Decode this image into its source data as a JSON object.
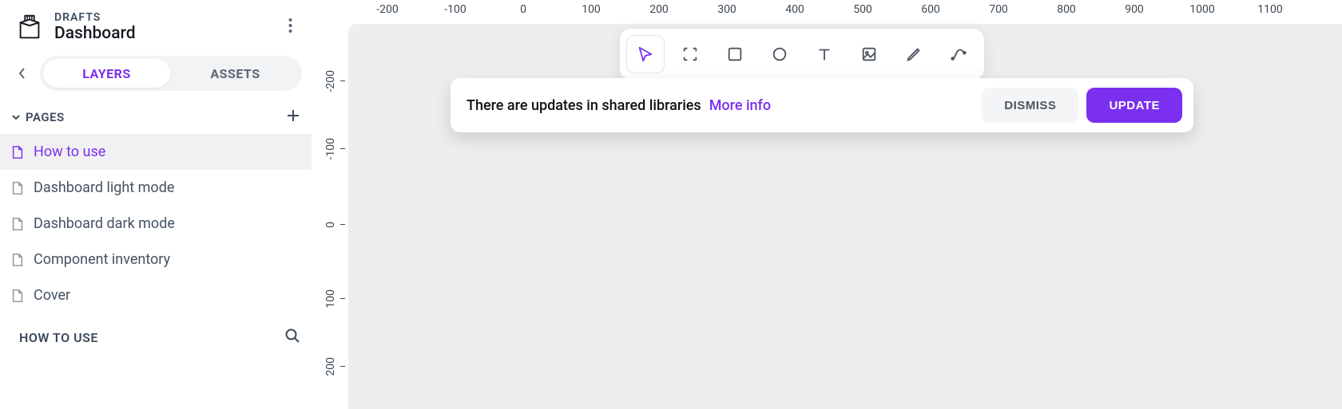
{
  "header": {
    "breadcrumb": "DRAFTS",
    "title": "Dashboard"
  },
  "tabs": {
    "layers": "LAYERS",
    "assets": "ASSETS"
  },
  "pages_section": {
    "label": "PAGES"
  },
  "pages": [
    {
      "label": "How to use",
      "active": true
    },
    {
      "label": "Dashboard light mode",
      "active": false
    },
    {
      "label": "Dashboard dark mode",
      "active": false
    },
    {
      "label": "Component inventory",
      "active": false
    },
    {
      "label": "Cover",
      "active": false
    }
  ],
  "layer_section": {
    "title": "HOW TO USE"
  },
  "ruler_h": [
    "-200",
    "-100",
    "0",
    "100",
    "200",
    "300",
    "400",
    "500",
    "600",
    "700",
    "800",
    "900",
    "1000",
    "1100"
  ],
  "ruler_v": [
    "-200",
    "-100",
    "0",
    "100",
    "200"
  ],
  "notification": {
    "text": "There are updates in shared libraries",
    "link": "More info",
    "dismiss": "DISMISS",
    "update": "UPDATE"
  },
  "colors": {
    "accent": "#7b2fef"
  }
}
